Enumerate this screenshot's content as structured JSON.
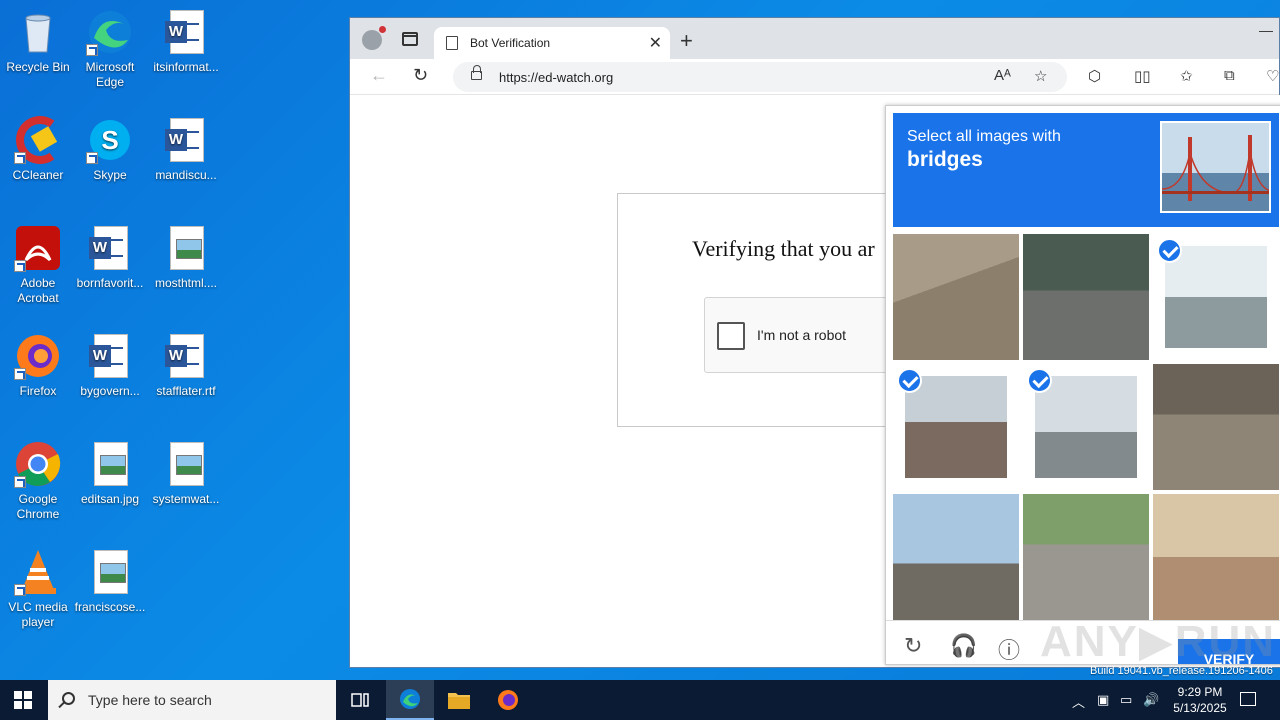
{
  "desktop": {
    "icons": [
      {
        "label": "Recycle Bin"
      },
      {
        "label": "Microsoft Edge"
      },
      {
        "label": "itsinformat..."
      },
      {
        "label": "CCleaner"
      },
      {
        "label": "Skype"
      },
      {
        "label": "mandiscu..."
      },
      {
        "label": "Adobe Acrobat"
      },
      {
        "label": "bornfavorit..."
      },
      {
        "label": "mosthtml...."
      },
      {
        "label": "Firefox"
      },
      {
        "label": "bygovern..."
      },
      {
        "label": "stafflater.rtf"
      },
      {
        "label": "Google Chrome"
      },
      {
        "label": "editsan.jpg"
      },
      {
        "label": "systemwat..."
      },
      {
        "label": "VLC media player"
      },
      {
        "label": "franciscose..."
      }
    ]
  },
  "browser": {
    "tab_title": "Bot Verification",
    "tab_close": "✕",
    "new_tab": "+",
    "window_min": "—",
    "back": "←",
    "reload": "↻",
    "url": "https://ed-watch.org",
    "toolbar_icons": [
      "Aᴬ",
      "☆",
      "⬡",
      "▯▯",
      "✩",
      "⧉",
      "♡"
    ]
  },
  "page": {
    "verify_heading": "Verifying that you ar",
    "checkbox_label": "I'm not a robot"
  },
  "captcha": {
    "instruction_pre": "Select all images with",
    "instruction_target": "bridges",
    "tiles": [
      {
        "desc": "motorcycle on sand",
        "selected": false
      },
      {
        "desc": "parked scooters",
        "selected": false
      },
      {
        "desc": "elevated highway",
        "selected": true
      },
      {
        "desc": "overpass bridge",
        "selected": true
      },
      {
        "desc": "arched bridge with bus",
        "selected": true
      },
      {
        "desc": "motorcycle on street",
        "selected": false
      },
      {
        "desc": "highway overpass",
        "selected": false
      },
      {
        "desc": "street with car",
        "selected": false
      },
      {
        "desc": "house balcony",
        "selected": false
      }
    ],
    "footer": {
      "reload_icon": "↻",
      "audio_icon": "🎧",
      "info_icon": "ⓘ",
      "verify_label": "VERIFY"
    }
  },
  "watermark": "ANY▶RUN",
  "build_text": "Build 19041.vb_release.191206-1406",
  "taskbar": {
    "search_placeholder": "Type here to search",
    "time": "9:29 PM",
    "date": "5/13/2025"
  }
}
